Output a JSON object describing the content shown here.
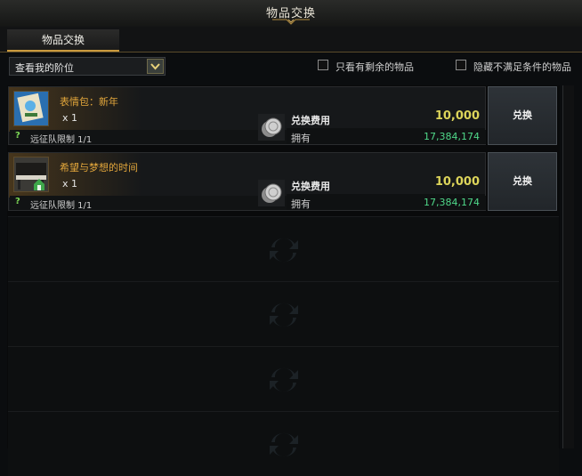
{
  "window": {
    "title": "物品交换"
  },
  "tabs": [
    {
      "label": "物品交换",
      "active": true
    }
  ],
  "filter": {
    "selected": "查看我的阶位"
  },
  "checkboxes": [
    {
      "label": "只看有剩余的物品",
      "checked": false
    },
    {
      "label": "隐藏不满足条件的物品",
      "checked": false
    }
  ],
  "items": [
    {
      "name": "表情包：新年",
      "quantity": "x 1",
      "limit_icon": "?",
      "limit": "远征队限制 1/1",
      "cost_label": "兑换费用",
      "cost": "10,000",
      "owned_label": "拥有",
      "owned": "17,384,174",
      "button": "兑换",
      "icon": "emote-pack-icon"
    },
    {
      "name": "希望与梦想的时间",
      "quantity": "x 1",
      "limit_icon": "?",
      "limit": "远征队限制 1/1",
      "cost_label": "兑换费用",
      "cost": "10,000",
      "owned_label": "拥有",
      "owned": "17,384,174",
      "button": "兑换",
      "icon": "piano-house-icon"
    }
  ],
  "colors": {
    "accent_gold": "#c99a3e",
    "item_name": "#e2a63b",
    "cost": "#dcd45a",
    "owned": "#4fd889"
  }
}
